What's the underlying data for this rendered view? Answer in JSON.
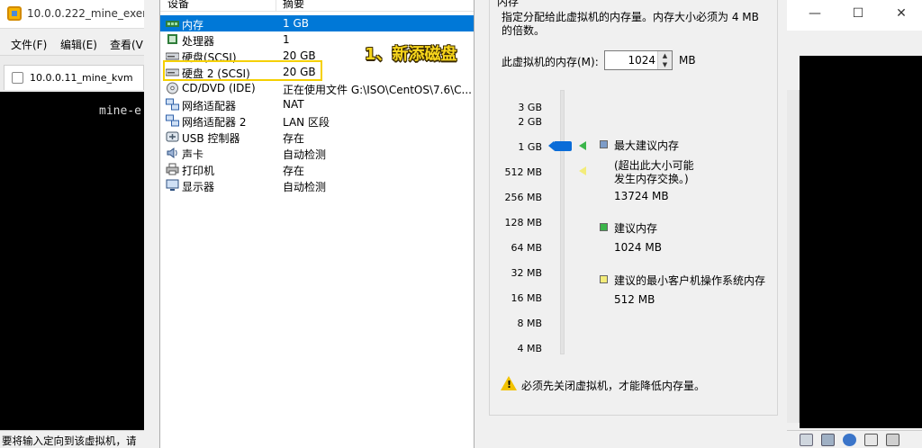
{
  "background_window": {
    "title": "10.0.0.222_mine_exerc",
    "menu": [
      "文件(F)",
      "编辑(E)",
      "查看(V"
    ],
    "tab_label": "10.0.0.11_mine_kvm",
    "console_text": "mine-e",
    "status_text": "要将输入定向到该虚拟机，请"
  },
  "device_list": {
    "columns": [
      "设备",
      "摘要"
    ],
    "rows": [
      {
        "name": "内存",
        "summary": "1 GB",
        "icon": "memory-icon",
        "selected": true
      },
      {
        "name": "处理器",
        "summary": "1",
        "icon": "processor-icon"
      },
      {
        "name": "硬盘(SCSI)",
        "summary": "20 GB",
        "icon": "hard-disk-icon"
      },
      {
        "name": "硬盘 2 (SCSI)",
        "summary": "20 GB",
        "icon": "hard-disk-icon"
      },
      {
        "name": "CD/DVD (IDE)",
        "summary": "正在使用文件 G:\\ISO\\CentOS\\7.6\\C...",
        "icon": "cd-dvd-icon"
      },
      {
        "name": "网络适配器",
        "summary": "NAT",
        "icon": "network-adapter-icon"
      },
      {
        "name": "网络适配器 2",
        "summary": "LAN 区段",
        "icon": "network-adapter-icon"
      },
      {
        "name": "USB 控制器",
        "summary": "存在",
        "icon": "usb-icon"
      },
      {
        "name": "声卡",
        "summary": "自动检测",
        "icon": "sound-card-icon"
      },
      {
        "name": "打印机",
        "summary": "存在",
        "icon": "printer-icon"
      },
      {
        "name": "显示器",
        "summary": "自动检测",
        "icon": "display-icon"
      }
    ]
  },
  "annotation": "1、新添磁盘",
  "memory": {
    "group_title": "内存",
    "description": "指定分配给此虚拟机的内存量。内存大小必须为 4 MB 的倍数。",
    "field_label": "此虚拟机的内存(M):",
    "value": "1024",
    "unit": "MB",
    "scale_labels": [
      "3 GB",
      "2 GB",
      "1 GB",
      "512 MB",
      "256 MB",
      "128 MB",
      "64 MB",
      "32 MB",
      "16 MB",
      "8 MB",
      "4 MB"
    ],
    "legend": {
      "max_title": "最大建议内存",
      "max_note": "(超出此大小可能\n发生内存交换。)",
      "max_value": "13724 MB",
      "recommended_title": "建议内存",
      "recommended_value": "1024 MB",
      "min_title": "建议的最小客户机操作系统内存",
      "min_value": "512 MB"
    },
    "warning": "必须先关闭虚拟机，才能降低内存量。"
  },
  "colors": {
    "selection": "#0078d7",
    "highlight_box": "#f5d000",
    "annotation": "#f7d61c",
    "max_marker": "#7d9cc8",
    "recommended_marker": "#3bb54a",
    "min_marker": "#f3ec7a"
  }
}
